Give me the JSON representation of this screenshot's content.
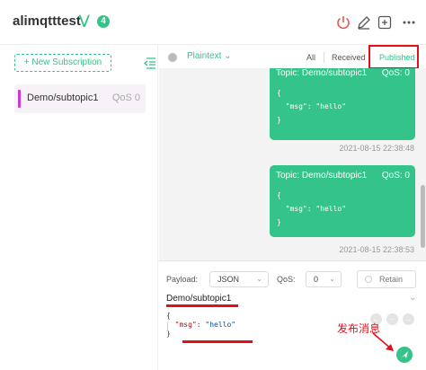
{
  "header": {
    "title": "alimqtttest",
    "expand_icon": "double-chevron-down-icon",
    "badge_count": "4",
    "icons": [
      "power-icon",
      "edit-icon",
      "new-window-icon",
      "more-icon"
    ]
  },
  "sidebar": {
    "new_subscription_label": "+ New Subscription",
    "collapse_icon": "collapse-list-icon",
    "subscriptions": [
      {
        "topic": "Demo/subtopic1",
        "qos": "QoS 0",
        "color": "#c73bd4"
      }
    ]
  },
  "toolbar": {
    "payload_format": "Plaintext",
    "tabs": {
      "all": "All",
      "received": "Received",
      "published": "Published"
    }
  },
  "messages": [
    {
      "topic": "Topic: Demo/subtopic1",
      "qos": "QoS: 0",
      "payload": "{\n  \"msg\": \"hello\"\n}",
      "time": "2021-08-15 22:38:48"
    },
    {
      "topic": "Topic: Demo/subtopic1",
      "qos": "QoS: 0",
      "payload": "{\n  \"msg\": \"hello\"\n}",
      "time": "2021-08-15 22:38:53"
    }
  ],
  "compose": {
    "payload_label": "Payload:",
    "payload_type": "JSON",
    "qos_label": "QoS:",
    "qos_value": "0",
    "retain_label": "Retain",
    "topic": "Demo/subtopic1",
    "code_open": "{",
    "code_key": "\"msg\"",
    "code_colon": ": ",
    "code_value": "\"hello\"",
    "code_close": "}",
    "annotation": "发布消息",
    "send_icon": "send-icon"
  },
  "colors": {
    "accent": "#34c388",
    "highlight": "#e0111b",
    "subscription": "#c73bd4"
  }
}
